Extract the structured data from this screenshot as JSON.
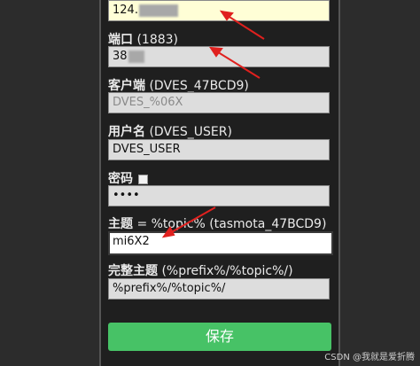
{
  "form": {
    "host": {
      "value": "124."
    },
    "port": {
      "label": "端口",
      "hint": "(1883)",
      "value": "38"
    },
    "client": {
      "label": "客户端",
      "hint": "(DVES_47BCD9)",
      "placeholder": "DVES_%06X"
    },
    "user": {
      "label": "用户名",
      "hint": "(DVES_USER)",
      "value": "DVES_USER"
    },
    "password": {
      "label": "密码",
      "value": "••••"
    },
    "topic": {
      "label": "主题",
      "hint": "= %topic% (tasmota_47BCD9)",
      "value": "mi6X2"
    },
    "full_topic": {
      "label": "完整主题",
      "hint": "(%prefix%/%topic%/)",
      "value": "%prefix%/%topic%/"
    },
    "save_label": "保存"
  },
  "watermark": "CSDN @我就是爱折腾",
  "colors": {
    "accent_green": "#47c266",
    "arrow_red": "#e0201e"
  }
}
